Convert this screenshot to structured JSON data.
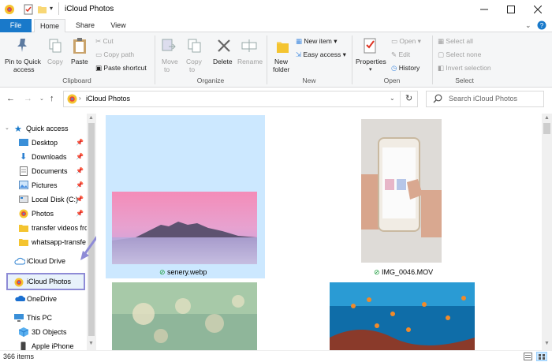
{
  "window": {
    "title": "iCloud Photos",
    "minimize_icon": "minimize-icon",
    "maximize_icon": "maximize-icon",
    "close_icon": "close-icon",
    "help_icon": "help-icon"
  },
  "tabs": [
    {
      "label": "File"
    },
    {
      "label": "Home"
    },
    {
      "label": "Share"
    },
    {
      "label": "View"
    }
  ],
  "ribbon": {
    "clipboard": {
      "pin_label_1": "Pin to Quick",
      "pin_label_2": "access",
      "copy": "Copy",
      "paste": "Paste",
      "cut": "Cut",
      "copy_path": "Copy path",
      "paste_shortcut": "Paste shortcut",
      "group": "Clipboard"
    },
    "organize": {
      "move_to_1": "Move",
      "move_to_2": "to",
      "copy_to_1": "Copy",
      "copy_to_2": "to",
      "delete": "Delete",
      "rename": "Rename",
      "group": "Organize"
    },
    "new": {
      "new_folder_1": "New",
      "new_folder_2": "folder",
      "new_item": "New item",
      "easy_access": "Easy access",
      "group": "New"
    },
    "open": {
      "properties": "Properties",
      "open": "Open",
      "edit": "Edit",
      "history": "History",
      "group": "Open"
    },
    "select": {
      "select_all": "Select all",
      "select_none": "Select none",
      "invert": "Invert selection",
      "group": "Select"
    }
  },
  "address": {
    "path": "iCloud Photos",
    "search_placeholder": "Search iCloud Photos"
  },
  "sidebar": {
    "quick_access": "Quick access",
    "items": [
      {
        "label": "Desktop"
      },
      {
        "label": "Downloads"
      },
      {
        "label": "Documents"
      },
      {
        "label": "Pictures"
      },
      {
        "label": "Local Disk (C:)"
      },
      {
        "label": "Photos"
      },
      {
        "label": "transfer videos fro"
      },
      {
        "label": "whatsapp-transfe"
      }
    ],
    "icloud_drive": "iCloud Drive",
    "icloud_photos": "iCloud Photos",
    "onedrive": "OneDrive",
    "this_pc": "This PC",
    "objects3d": "3D Objects",
    "apple_iphone": "Apple iPhone"
  },
  "files": [
    {
      "name": "senery.webp"
    },
    {
      "name": "IMG_0046.MOV"
    }
  ],
  "status": {
    "count": "366 items"
  },
  "colors": {
    "accent": "#1979ca",
    "selection": "#cce8ff",
    "highlight_border": "#8e8bd6",
    "sync_green": "#1a9b3a"
  }
}
